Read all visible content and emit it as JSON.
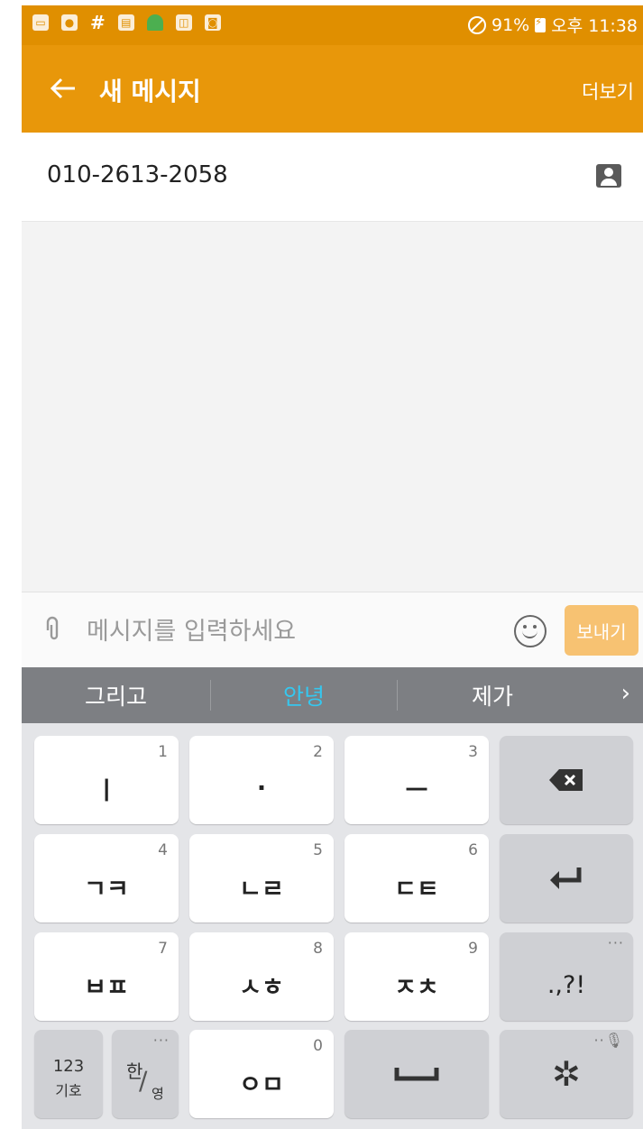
{
  "status_bar": {
    "battery": "91%",
    "time": "오후 11:38",
    "icons": [
      "gallery-icon",
      "shield-icon",
      "hash-icon",
      "message-icon",
      "android-icon",
      "screen-icon",
      "photo-icon",
      "dnd-icon",
      "battery-icon"
    ]
  },
  "app_bar": {
    "title": "새 메시지",
    "more_label": "더보기"
  },
  "recipient": {
    "number": "010-2613-2058"
  },
  "compose": {
    "placeholder": "메시지를 입력하세요",
    "send_label": "보내기"
  },
  "suggestions": [
    "그리고",
    "안녕",
    "제가"
  ],
  "keyboard": {
    "row1": [
      {
        "main": "ㅣ",
        "hint": "1"
      },
      {
        "main": "·",
        "hint": "2"
      },
      {
        "main": "ㅡ",
        "hint": "3"
      }
    ],
    "row2": [
      {
        "main": "ㄱㅋ",
        "hint": "4"
      },
      {
        "main": "ㄴㄹ",
        "hint": "5"
      },
      {
        "main": "ㄷㅌ",
        "hint": "6"
      }
    ],
    "row3": [
      {
        "main": "ㅂㅍ",
        "hint": "7"
      },
      {
        "main": "ㅅㅎ",
        "hint": "8"
      },
      {
        "main": "ㅈㅊ",
        "hint": "9"
      }
    ],
    "punct_label": ".,?!",
    "sym_top": "123",
    "sym_bottom": "기호",
    "lang_top": "한",
    "lang_bottom": "영",
    "row4_main": "ㅇㅁ",
    "row4_hint": "0"
  },
  "colors": {
    "status_bar": "#e08f00",
    "app_bar": "#e8970a",
    "send_button": "#f7c272",
    "suggestion_bar": "#7d7f83",
    "suggestion_highlight": "#35c7ef",
    "keyboard_bg": "#e4e5e8"
  }
}
